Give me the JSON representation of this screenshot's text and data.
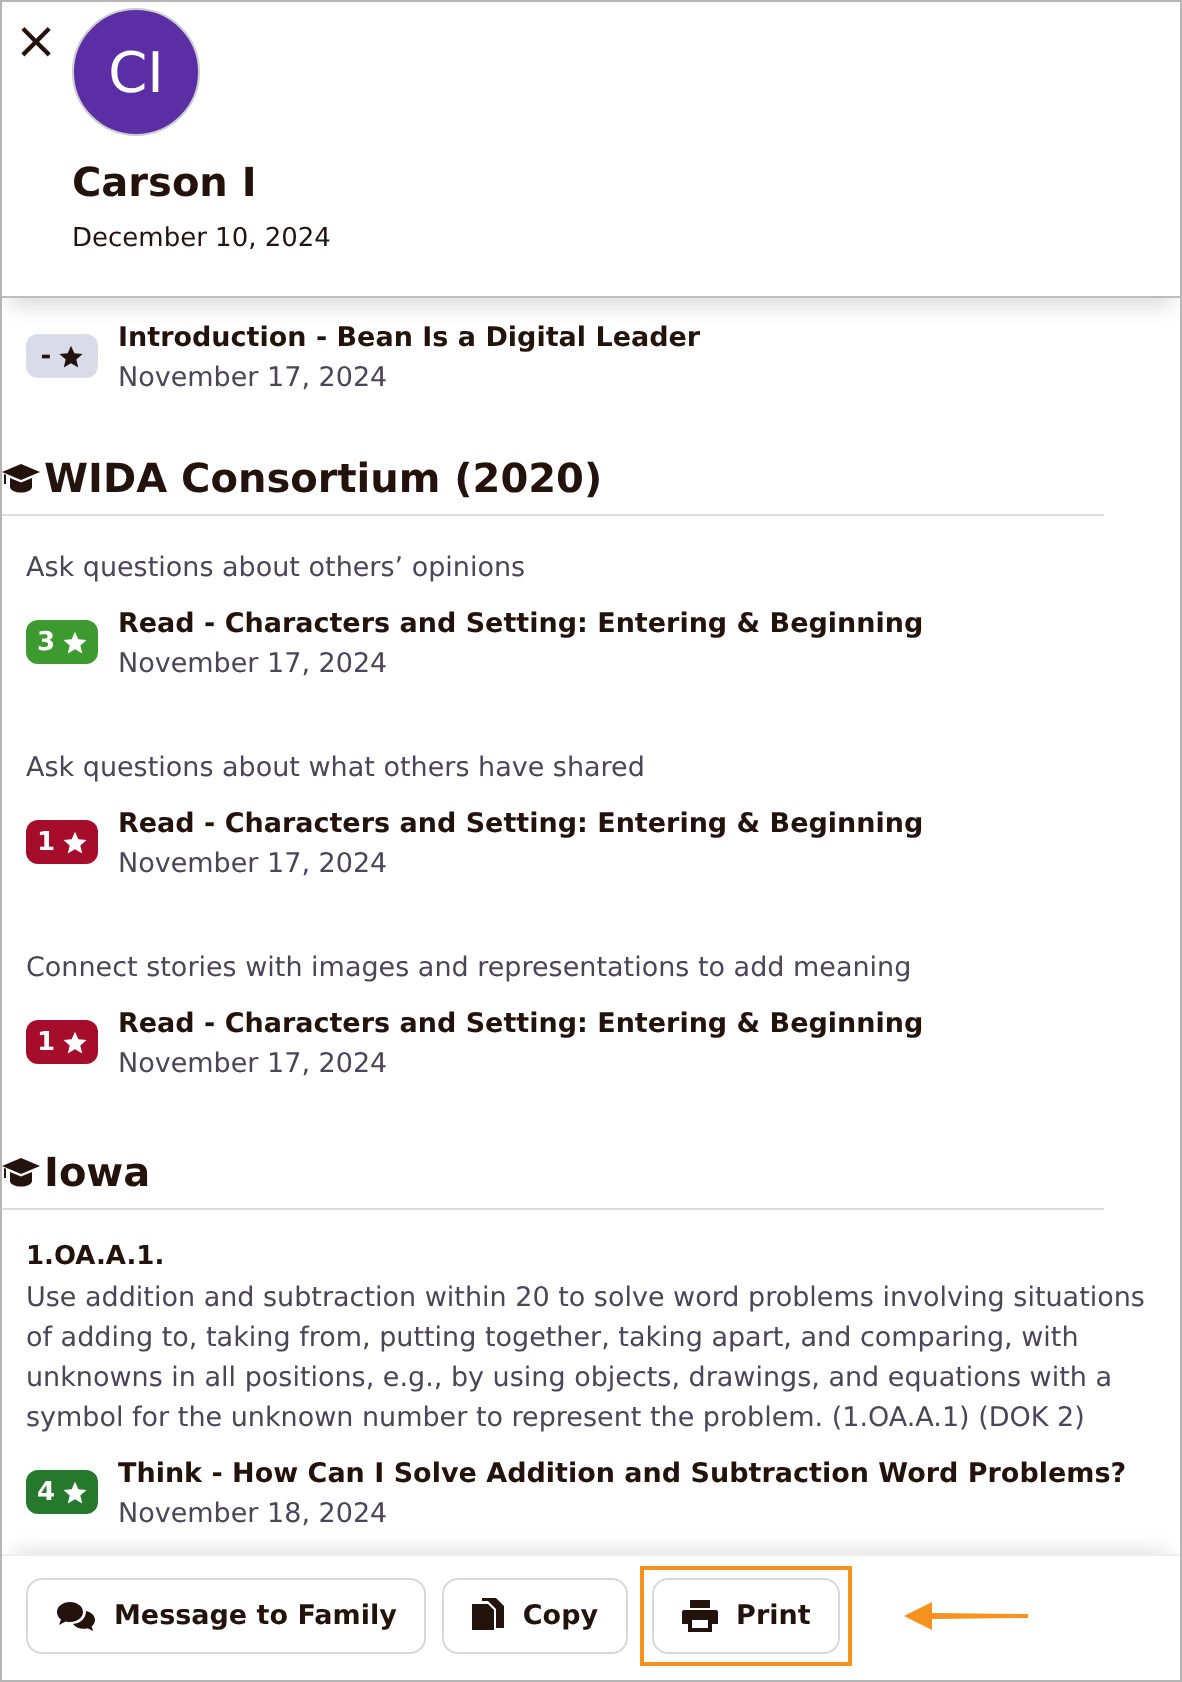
{
  "header": {
    "close": "×",
    "avatar": {
      "initials": "CI",
      "color": "#5b2ea6"
    },
    "name": "Carson I",
    "date": "December 10, 2024"
  },
  "groups": [
    {
      "items": [
        {
          "activity": "Introduction - Bean Is a Digital Leader",
          "date": "November 17, 2024",
          "badge": {
            "score": "-",
            "color": "#d9dce8"
          }
        }
      ]
    },
    {
      "title": "WIDA Consortium (2020)",
      "items": [
        {
          "standard": "Ask questions about others’ opinions",
          "activity": "Read - Characters and Setting: Entering & Beginning",
          "date": "November 17, 2024",
          "badge": {
            "score": "3",
            "color": "#3d9a2f"
          }
        },
        {
          "standard": "Ask questions about what others have shared",
          "activity": "Read - Characters and Setting: Entering & Beginning",
          "date": "November 17, 2024",
          "badge": {
            "score": "1",
            "color": "#a50d2b"
          }
        },
        {
          "standard": "Connect stories with images and representations to add meaning",
          "activity": "Read - Characters and Setting: Entering & Beginning",
          "date": "November 17, 2024",
          "badge": {
            "score": "1",
            "color": "#a50d2b"
          }
        }
      ]
    },
    {
      "title": "Iowa",
      "items": [
        {
          "code": "1.OA.A.1.",
          "standard": "Use addition and subtraction within 20 to solve word problems involving situations of adding to, taking from, putting together, taking apart, and comparing, with unknowns in all positions, e.g., by using objects, drawings, and equations with a symbol for the unknown number to represent the problem. (1.OA.A.1) (DOK 2)",
          "activity": "Think - How Can I Solve Addition and Subtraction Word Problems?",
          "date": "November 18, 2024",
          "badge": {
            "score": "4",
            "color": "#25782c"
          }
        }
      ]
    }
  ],
  "footer": {
    "buttons": [
      {
        "kind": "message",
        "label": "Message to Family",
        "highlighted": false
      },
      {
        "kind": "copy",
        "label": "Copy",
        "highlighted": false
      },
      {
        "kind": "print",
        "label": "Print",
        "highlighted": true
      }
    ]
  }
}
